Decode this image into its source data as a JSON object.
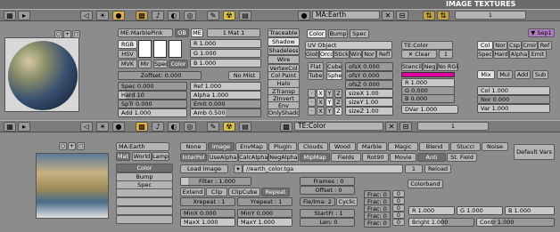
{
  "top": {
    "corner_label": "IMAGE TEXTURES",
    "mat_field": "MA:Earth",
    "num": "1"
  },
  "material": {
    "me_name": "ME:MarblePink",
    "ob": "OB",
    "me": "ME",
    "slot": "1 Mat 1",
    "traceable": "Traceable",
    "shadow": "Shadow",
    "shadeless": "Shadeless",
    "wire": "Wire",
    "vertexcol": "VertexCol",
    "colpaint": "Col Paint",
    "halo": "Halo",
    "ztransp": "ZTransp",
    "zinvert": "ZInvert",
    "env": "Env",
    "onlyshadow": "OnlyShadow",
    "rgb": "RGB",
    "hsv": "HSV",
    "mvk": "MVK",
    "mir": "Mir",
    "spec": "Spec",
    "color": "Color",
    "zoffset": "Zoffset: 0.000",
    "nomist": "No Mist",
    "r": "R 1.000",
    "g": "G 1.000",
    "b": "B 1.000",
    "spec_val": "Spec 0.000",
    "hard": "Hard 10",
    "sptr": "SpTr 0.000",
    "add": "Add 1.000",
    "ref": "Ref 1.000",
    "alpha": "Alpha 1.000",
    "emit": "Emit 0.000",
    "amb": "Amb 0.500",
    "tab_color": "Color",
    "tab_bump": "Bump",
    "tab_spec": "Spec",
    "uv_object": "UV Object",
    "glob": "Glob",
    "orco": "Orco",
    "stick": "Stick",
    "win": "Win",
    "nor": "Nor",
    "refl": "Refl",
    "flat": "Flat",
    "cube": "Cube",
    "tube": "Tube",
    "sphe": "Sphe",
    "ofsx": "ofsX 0.000",
    "ofsy": "ofsY 0.000",
    "ofsz": "ofsZ 0.000",
    "sizex": "sizeX 1.00",
    "sizey": "sizeY 1.00",
    "sizez": "sizeZ 1.00",
    "te_color": "TE:Color",
    "clear": "Clear",
    "clear_num": "1",
    "stencil": "Stencil",
    "neg": "Neg",
    "norgb": "No RGB",
    "tr": "R 1.000",
    "tg": "G 0.000",
    "tb": "B 0.000",
    "dvar": "DVar 1.000",
    "col": "Col",
    "nor2": "Nor",
    "csp": "Csp",
    "cmir": "Cmir",
    "ref2": "Ref",
    "spec2": "Spec",
    "hard2": "Hard",
    "alpha2": "Alpha",
    "emit2": "Emit",
    "mix": "Mix",
    "mul": "Mul",
    "add2": "Add",
    "sub": "Sub",
    "colv": "Col 1.000",
    "norv": "Nor 0.000",
    "varv": "Var 1.000",
    "sep": "Sep1"
  },
  "texture_header": {
    "te": "TE:Color",
    "num": "1"
  },
  "texture": {
    "ma": "MA:Earth",
    "mat": "Mat",
    "world": "World",
    "lamp": "Lamp",
    "channels": [
      "Color",
      "Bump",
      "Spec",
      "",
      "",
      "",
      ""
    ],
    "types": [
      "None",
      "Image",
      "EnvMap",
      "Plugin",
      "Clouds",
      "Wood",
      "Marble",
      "Magic",
      "Blend",
      "Stucci",
      "Noise"
    ],
    "opts": [
      "InterPol",
      "UseAlpha",
      "CalcAlpha",
      "NegAlpha",
      "MipMap",
      "Fields",
      "Rot90",
      "Movie",
      "Anti",
      "St. Field"
    ],
    "defaultvars": "Default Vars",
    "loadimage": "Load Image",
    "path": "//earth_color.tga",
    "path_num": "1",
    "reload": "Reload",
    "filter": "Filter : 1.000",
    "frames": "Frames : 0",
    "offset": "Offset : 0",
    "extend": "Extend",
    "clip": "Clip",
    "clipcube": "ClipCube",
    "repeat": "Repeat",
    "xrepeat": "Xrepeat : 1",
    "yrepeat": "Yrepeat : 1",
    "fieima": "Fie/Ima: 2",
    "cyclic": "Cyclic",
    "minx": "MinX 0.000",
    "miny": "MinY 0.000",
    "maxx": "MaxX 1.000",
    "maxy": "MaxY 1.000",
    "startfr": "StartFr : 1",
    "len": "Len: 0",
    "colorband": "Colorband",
    "frac": [
      "Frac: 0",
      "Frac: 0",
      "Frac: 0",
      "Frac: 0",
      "Frac: 0"
    ],
    "zeros": [
      "0",
      "0",
      "0",
      "0",
      "0"
    ],
    "r": "R 1.000",
    "g": "G 1.000",
    "b": "B 1.000",
    "bright": "Bright 1.000",
    "contr": "Contr 1.000"
  }
}
